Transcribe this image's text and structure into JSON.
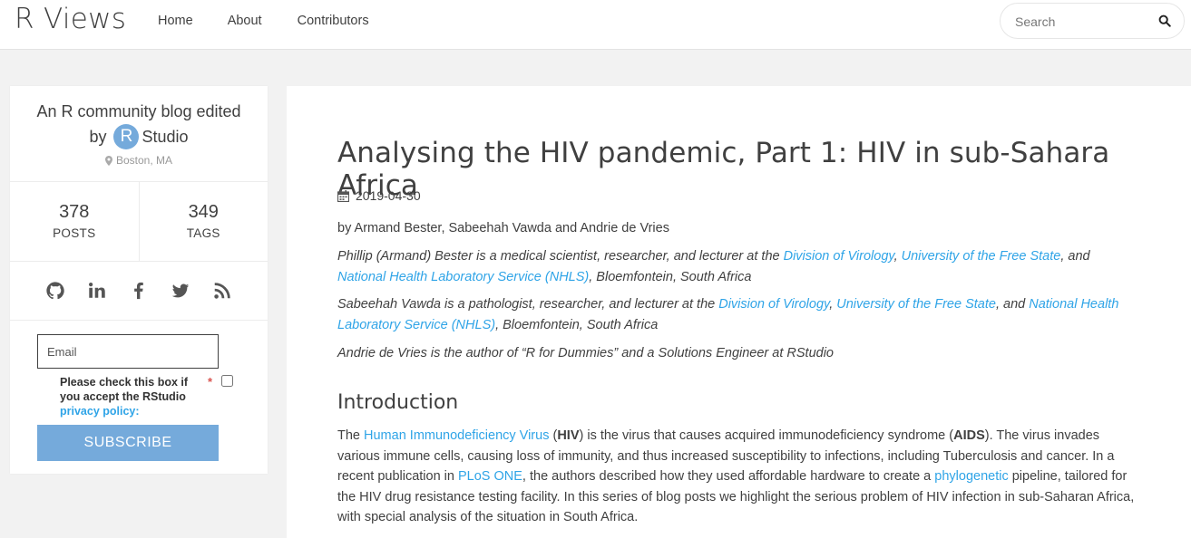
{
  "navbar": {
    "brand": "R Views",
    "links": [
      "Home",
      "About",
      "Contributors"
    ],
    "search_placeholder": "Search"
  },
  "sidebar": {
    "about_line1": "An R community blog edited",
    "about_by": "by",
    "logo_letter": "R",
    "about_studio": "Studio",
    "location": "Boston, MA",
    "stats": [
      {
        "value": "378",
        "label": "POSTS"
      },
      {
        "value": "349",
        "label": "TAGS"
      }
    ],
    "social_icons": [
      "github-icon",
      "linkedin-icon",
      "facebook-icon",
      "twitter-icon",
      "rss-icon"
    ],
    "email_placeholder": "Email",
    "consent_text": "Please check this box if you accept the RStudio",
    "consent_link": "privacy policy:",
    "required_mark": "*",
    "subscribe_label": "SUBSCRIBE"
  },
  "post": {
    "title": "Analysing the HIV pandemic, Part 1: HIV in sub-Sahara Africa",
    "date": "2019-04-30",
    "authors": "by Armand Bester, Sabeehah Vawda and Andrie de Vries",
    "bio1": {
      "pre": "Phillip (Armand) Bester is a medical scientist, researcher, and lecturer at the ",
      "link1": "Division of Virology",
      "sep1": ", ",
      "link2": "University of the Free State",
      "sep2": ", and ",
      "link3": "National Health Laboratory Service (NHLS)",
      "post": ", Bloemfontein, South Africa"
    },
    "bio2": {
      "pre": "Sabeehah Vawda is a pathologist, researcher, and lecturer at the ",
      "link1": "Division of Virology",
      "sep1": ", ",
      "link2": "University of the Free State",
      "sep2": ", and ",
      "link3": "National Health Laboratory Service (NHLS)",
      "post": ", Bloemfontein, South Africa"
    },
    "bio3": "Andrie de Vries is the author of “R for Dummies” and a Solutions Engineer at RStudio",
    "section_heading": "Introduction",
    "intro": {
      "t1": "The ",
      "link1": "Human Immunodeficiency Virus",
      "t2": " (",
      "b1": "HIV",
      "t3": ") is the virus that causes acquired immunodeficiency syndrome (",
      "b2": "AIDS",
      "t4": "). The virus invades various immune cells, causing loss of immunity, and thus increased susceptibility to infections, including Tuberculosis and cancer. In a recent publication in ",
      "link2": "PLoS ONE",
      "t5": ", the authors described how they used affordable hardware to create a ",
      "link3": "phylogenetic",
      "t6": " pipeline, tailored for the HIV drug resistance testing facility. In this series of blog posts we highlight the serious problem of HIV infection in sub-Saharan Africa, with special analysis of the situation in South Africa."
    }
  }
}
